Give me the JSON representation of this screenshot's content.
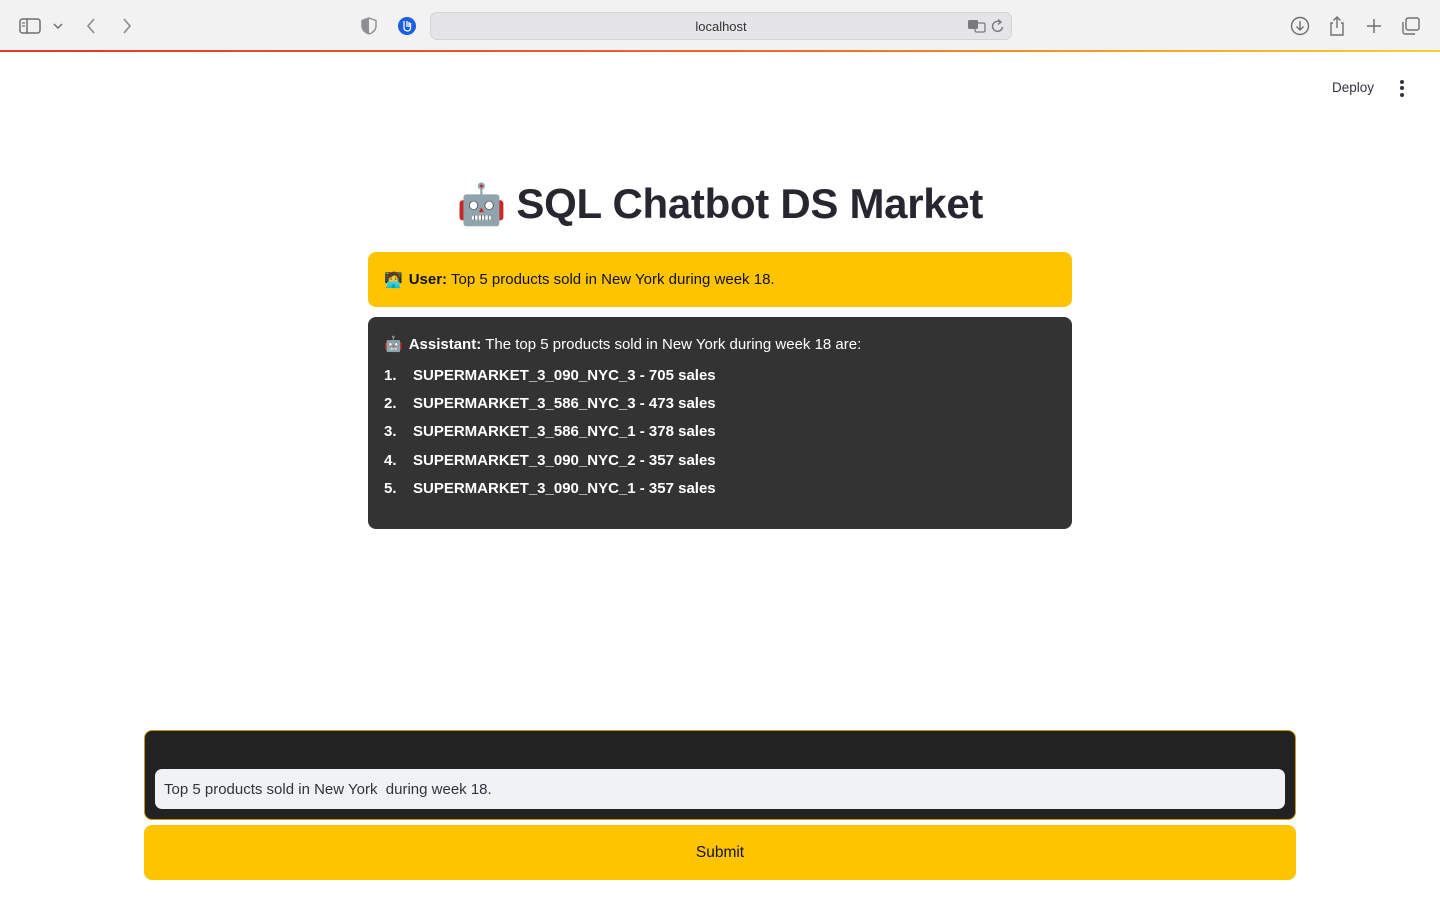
{
  "browser": {
    "url": "localhost"
  },
  "header": {
    "deploy_label": "Deploy"
  },
  "main": {
    "title_emoji": "🤖",
    "title": "SQL Chatbot DS Market",
    "messages": {
      "user": {
        "emoji": "🧑‍💻",
        "role": "User:",
        "text": "Top 5 products sold in New York during week 18."
      },
      "assistant": {
        "emoji": "🤖",
        "role": "Assistant:",
        "text": "The top 5 products sold in New York during week 18 are:",
        "items": [
          {
            "num": "1.",
            "text": "SUPERMARKET_3_090_NYC_3 - 705 sales"
          },
          {
            "num": "2.",
            "text": "SUPERMARKET_3_586_NYC_3 - 473 sales"
          },
          {
            "num": "3.",
            "text": "SUPERMARKET_3_586_NYC_1 - 378 sales"
          },
          {
            "num": "4.",
            "text": "SUPERMARKET_3_090_NYC_2 - 357 sales"
          },
          {
            "num": "5.",
            "text": "SUPERMARKET_3_090_NYC_1 - 357 sales"
          }
        ]
      }
    }
  },
  "form": {
    "input_value": "Top 5 products sold in New York  during week 18.",
    "submit_label": "Submit"
  },
  "colors": {
    "accent": "#ffc400",
    "assistant_bg": "#333333",
    "form_bg": "#222222"
  },
  "icons": [
    "sidebar-icon",
    "chevron-down-icon",
    "back-icon",
    "forward-icon",
    "shield-icon",
    "extension-icon",
    "translate-icon",
    "reload-icon",
    "download-icon",
    "share-icon",
    "new-tab-icon",
    "tabs-overview-icon",
    "kebab-menu-icon"
  ]
}
